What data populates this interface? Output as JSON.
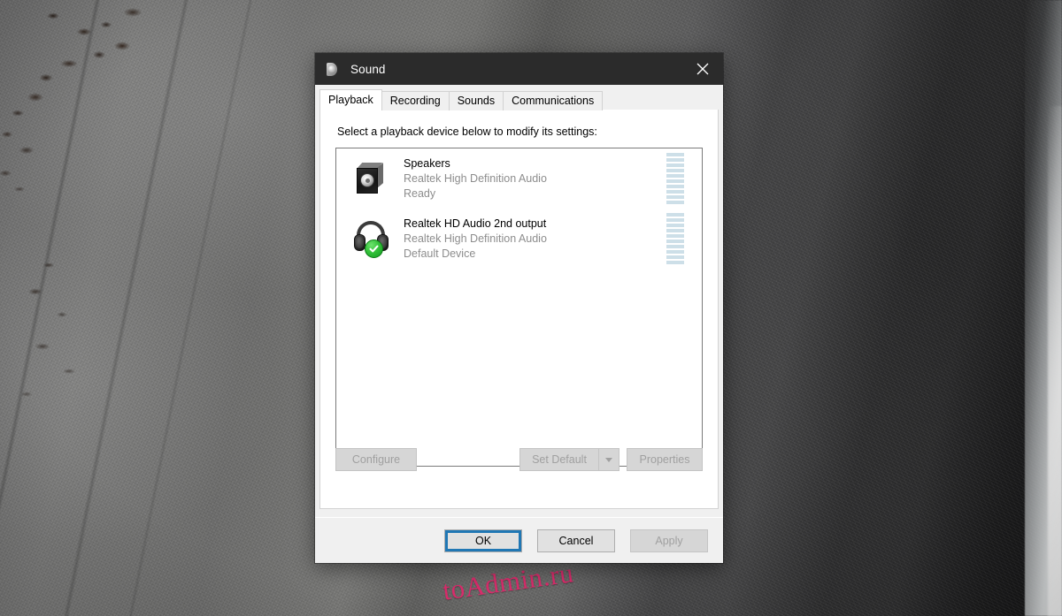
{
  "window": {
    "title": "Sound",
    "icon": "speaker-icon",
    "close_label": "Close"
  },
  "tabs": [
    {
      "label": "Playback",
      "active": true
    },
    {
      "label": "Recording",
      "active": false
    },
    {
      "label": "Sounds",
      "active": false
    },
    {
      "label": "Communications",
      "active": false
    }
  ],
  "playback": {
    "instruction": "Select a playback device below to modify its settings:",
    "devices": [
      {
        "icon": "speaker-icon",
        "name": "Speakers",
        "driver": "Realtek High Definition Audio",
        "status": "Ready",
        "is_default": false,
        "meter_segments": 10
      },
      {
        "icon": "headphones-icon",
        "name": "Realtek HD Audio 2nd output",
        "driver": "Realtek High Definition Audio",
        "status": "Default Device",
        "is_default": true,
        "meter_segments": 10
      }
    ]
  },
  "mid_buttons": {
    "configure": "Configure",
    "set_default": "Set Default",
    "set_default_dropdown": "chevron-down-icon",
    "properties": "Properties"
  },
  "commit_buttons": {
    "ok": "OK",
    "cancel": "Cancel",
    "apply": "Apply"
  },
  "watermark": {
    "text": "toAdmin.ru"
  },
  "colors": {
    "titlebar_bg": "#2b2b2b",
    "dialog_bg": "#f0f0f0",
    "focus_ring": "#2077b4",
    "default_badge_green": "#34c23a",
    "meter_segment": "#cddfe8",
    "disabled_text": "#a0a0a0",
    "secondary_text": "#8d8d8d",
    "watermark": "#e8246c"
  }
}
